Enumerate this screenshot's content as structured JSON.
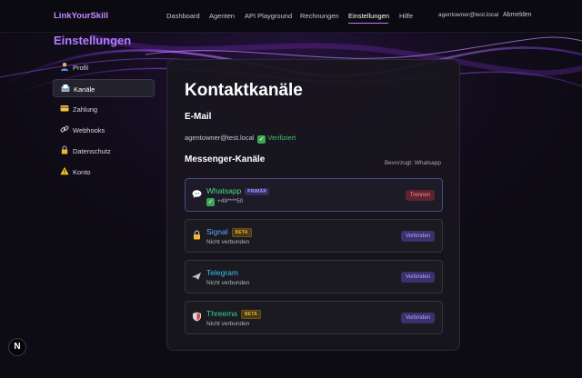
{
  "nav": {
    "brand": "LinkYourSkill",
    "links": [
      "Dashboard",
      "Agenten",
      "API Playground",
      "Rechnungen",
      "Einstellungen",
      "Hilfe"
    ],
    "active": "Einstellungen",
    "user_email": "agentowner@test.local",
    "logout": "Abmelden"
  },
  "page": {
    "title": "Einstellungen"
  },
  "sidebar": {
    "items": [
      {
        "label": "Profil",
        "icon": "user-icon"
      },
      {
        "label": "Kanäle",
        "icon": "inbox-icon",
        "active": true
      },
      {
        "label": "Zahlung",
        "icon": "credit-card-icon"
      },
      {
        "label": "Webhooks",
        "icon": "link-icon"
      },
      {
        "label": "Datenschutz",
        "icon": "lock-icon"
      },
      {
        "label": "Konto",
        "icon": "warning-icon"
      }
    ]
  },
  "content": {
    "heading": "Kontaktkanäle",
    "email_section": {
      "title": "E-Mail",
      "address": "agentowner@test.local",
      "status": "Verifiziert"
    },
    "messenger_section": {
      "title": "Messenger-Kanäle",
      "preferred": "Bevorzugt: Whatsapp",
      "channels": [
        {
          "name": "Whatsapp",
          "color": "#4ade80",
          "badge": "PRIMÄR",
          "sub": "+49****50",
          "button": "Trennen",
          "icon": "speech-bubble-icon"
        },
        {
          "name": "Signal",
          "color": "#60a5fa",
          "badge": "BETA",
          "sub": "Nicht verbunden",
          "button": "Verbinden",
          "icon": "lock-icon"
        },
        {
          "name": "Telegram",
          "color": "#38bdf8",
          "badge": "",
          "sub": "Nicht verbunden",
          "button": "Verbinden",
          "icon": "airplane-icon"
        },
        {
          "name": "Threema",
          "color": "#34d399",
          "badge": "BETA",
          "sub": "Nicht verbunden",
          "button": "Verbinden",
          "icon": "shield-icon"
        }
      ]
    }
  },
  "devtools": {
    "label": "N"
  }
}
